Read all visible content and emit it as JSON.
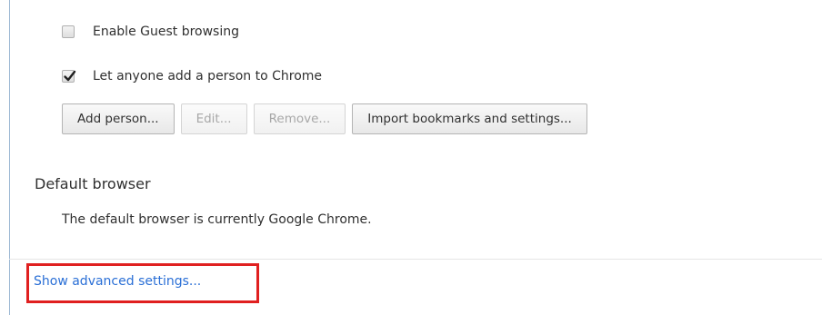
{
  "people": {
    "guest_browsing": {
      "label": "Enable Guest browsing",
      "checked": false
    },
    "add_person": {
      "label": "Let anyone add a person to Chrome",
      "checked": true
    },
    "buttons": {
      "add_person": "Add person...",
      "edit": "Edit...",
      "remove": "Remove...",
      "import": "Import bookmarks and settings..."
    }
  },
  "default_browser": {
    "title": "Default browser",
    "status": "The default browser is currently Google Chrome."
  },
  "footer": {
    "advanced_link": "Show advanced settings...",
    "highlight_color": "#e02020",
    "link_color": "#2a6fd6"
  }
}
